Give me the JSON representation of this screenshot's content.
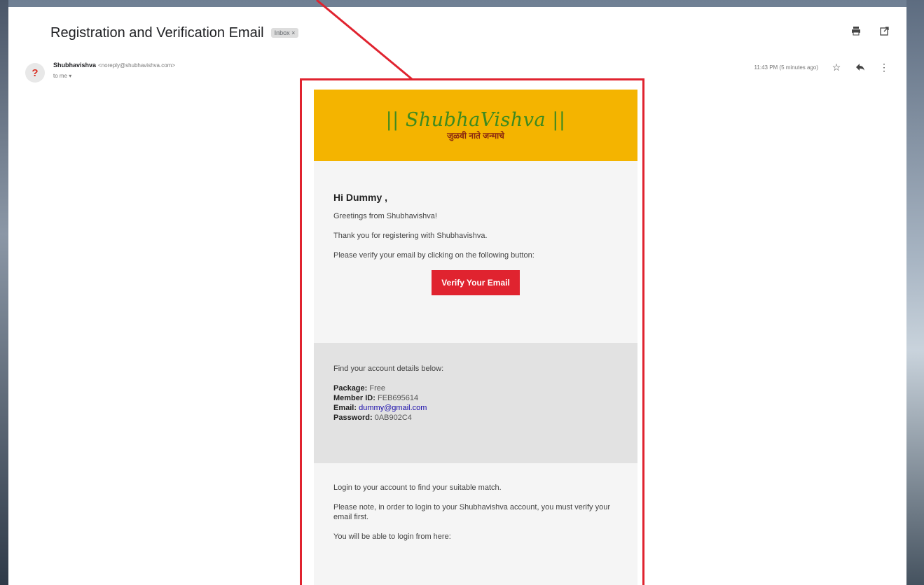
{
  "email": {
    "subject": "Registration and Verification Email",
    "label_chip": "Inbox ×",
    "sender_name": "Shubhavishva",
    "sender_email": "<noreply@shubhavishva.com>",
    "to": "to me ▾",
    "timestamp": "11:43 PM (5 minutes ago)",
    "avatar_letter": "?"
  },
  "banner": {
    "logo": "|| ShubhaVishva ||",
    "tagline": "जुळवी नाते जन्माचे",
    "bg_color": "#f4b400"
  },
  "body": {
    "greeting": "Hi Dummy ,",
    "line1": "Greetings from Shubhavishva!",
    "line2": "Thank you for registering with Shubhavishva.",
    "line3": "Please verify your email by clicking on the following button:",
    "verify_button": "Verify Your Email",
    "accent_color": "#e0232f"
  },
  "details": {
    "intro": "Find your account details below:",
    "package_label": "Package:",
    "package_value": "Free",
    "member_label": "Member ID:",
    "member_value": "FEB695614",
    "email_label": "Email:",
    "email_value": "dummy@gmail.com",
    "password_label": "Password:",
    "password_value": "0AB902C4"
  },
  "footer": {
    "line1": "Login to your account to find your suitable match.",
    "line2": "Please note, in order to login to your Shubhavishva account, you must verify your email first.",
    "line3": "You will be able to login from here:"
  }
}
